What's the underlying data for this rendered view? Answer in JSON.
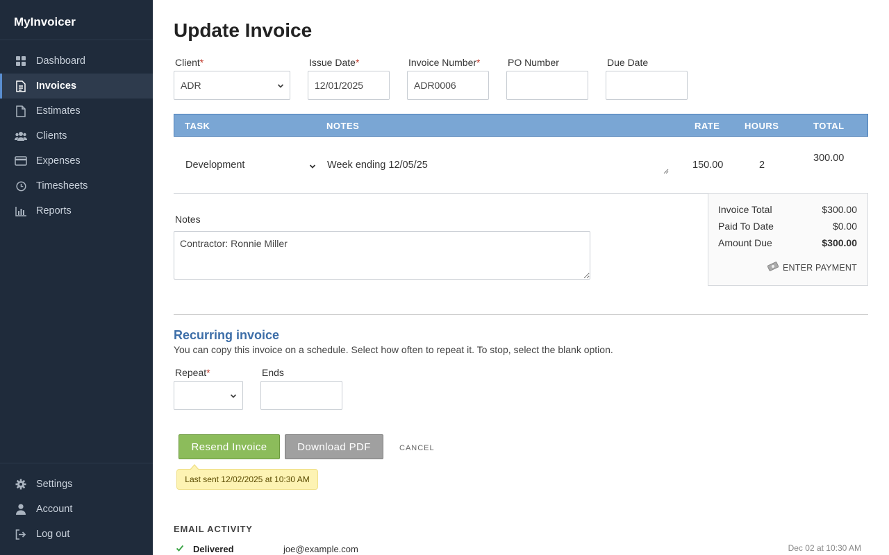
{
  "app": {
    "name": "MyInvoicer"
  },
  "sidebar": {
    "items": [
      {
        "label": "Dashboard",
        "icon": "dashboard-icon"
      },
      {
        "label": "Invoices",
        "icon": "invoice-icon",
        "active": true
      },
      {
        "label": "Estimates",
        "icon": "estimate-icon"
      },
      {
        "label": "Clients",
        "icon": "clients-icon"
      },
      {
        "label": "Expenses",
        "icon": "credit-card-icon"
      },
      {
        "label": "Timesheets",
        "icon": "clock-icon"
      },
      {
        "label": "Reports",
        "icon": "bar-chart-icon"
      }
    ],
    "bottom_items": [
      {
        "label": "Settings",
        "icon": "gear-icon"
      },
      {
        "label": "Account",
        "icon": "user-icon"
      },
      {
        "label": "Log out",
        "icon": "logout-icon"
      }
    ]
  },
  "page": {
    "title": "Update Invoice"
  },
  "form": {
    "client": {
      "label": "Client",
      "value": "ADR"
    },
    "issue_date": {
      "label": "Issue Date",
      "value": "12/01/2025"
    },
    "invoice_number": {
      "label": "Invoice Number",
      "value": "ADR0006"
    },
    "po_number": {
      "label": "PO Number",
      "value": ""
    },
    "due_date": {
      "label": "Due Date",
      "value": ""
    },
    "required_mark": "*"
  },
  "table": {
    "headers": {
      "task": "TASK",
      "notes": "NOTES",
      "rate": "RATE",
      "hours": "HOURS",
      "total": "TOTAL"
    },
    "rows": [
      {
        "task": "Development",
        "notes": "Week ending 12/05/25",
        "rate": "150.00",
        "hours": "2",
        "total": "300.00"
      }
    ]
  },
  "totals": {
    "invoice_total_label": "Invoice Total",
    "invoice_total": "$300.00",
    "paid_label": "Paid To Date",
    "paid": "$0.00",
    "due_label": "Amount Due",
    "due": "$300.00",
    "enter_payment": "ENTER PAYMENT"
  },
  "notes": {
    "label": "Notes",
    "value": "Contractor: Ronnie Miller"
  },
  "recurring": {
    "title": "Recurring invoice",
    "description": "You can copy this invoice on a schedule. Select how often to repeat it. To stop, select the blank option.",
    "repeat_label": "Repeat",
    "ends_label": "Ends"
  },
  "actions": {
    "resend": "Resend Invoice",
    "download": "Download PDF",
    "cancel": "CANCEL",
    "last_sent": "Last sent 12/02/2025 at 10:30 AM"
  },
  "email_activity": {
    "title": "EMAIL ACTIVITY",
    "rows": [
      {
        "status": "Delivered",
        "email": "joe@example.com",
        "time": "Dec 02 at 10:30 AM"
      }
    ]
  },
  "colors": {
    "sidebar_bg": "#1f2b3b",
    "table_header": "#7aa6d4",
    "primary_green": "#8cbc5b",
    "accent_blue": "#3d6ea8"
  }
}
